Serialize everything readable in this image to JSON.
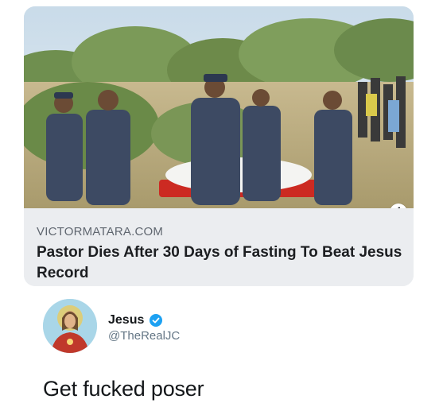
{
  "link_card": {
    "domain": "VICTORMATARA.COM",
    "headline": "Pastor Dies After 30 Days of Fasting To Beat Jesus Record",
    "info_icon": "info-icon"
  },
  "tweet": {
    "display_name": "Jesus",
    "verified_icon": "verified-badge-icon",
    "username": "@TheRealJC",
    "text": "Get fucked poser"
  },
  "colors": {
    "caption_bg": "#ebedf0",
    "domain_text": "#606770",
    "headline_text": "#1c1e21",
    "verified_blue": "#1da1f2",
    "username_text": "#657786"
  }
}
